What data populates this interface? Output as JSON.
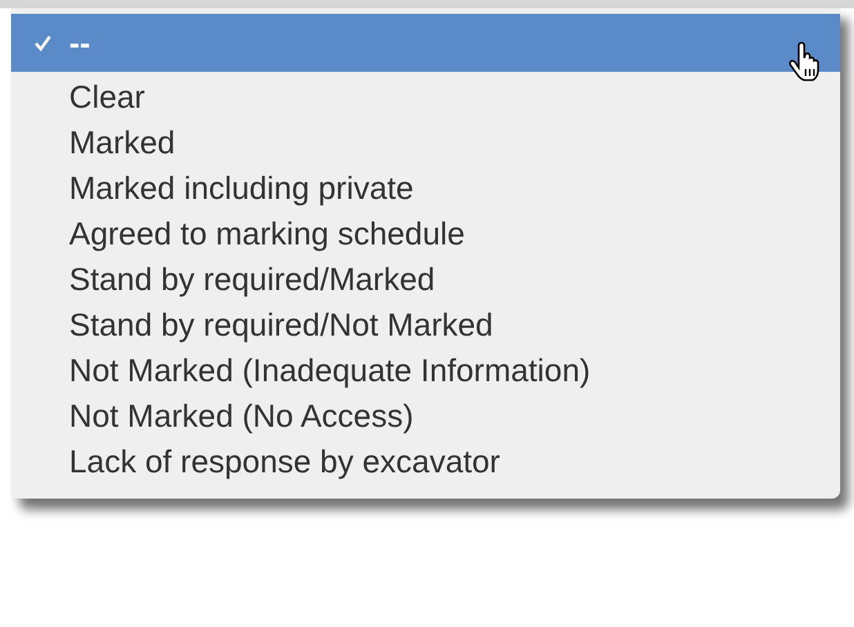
{
  "menu": {
    "items": [
      {
        "label": "--",
        "checked": true,
        "selected": true
      },
      {
        "label": "Clear",
        "checked": false,
        "selected": false
      },
      {
        "label": "Marked",
        "checked": false,
        "selected": false
      },
      {
        "label": "Marked including private",
        "checked": false,
        "selected": false
      },
      {
        "label": "Agreed to marking schedule",
        "checked": false,
        "selected": false
      },
      {
        "label": "Stand by required/Marked",
        "checked": false,
        "selected": false
      },
      {
        "label": "Stand by required/Not Marked",
        "checked": false,
        "selected": false
      },
      {
        "label": "Not Marked (Inadequate Information)",
        "checked": false,
        "selected": false
      },
      {
        "label": "Not Marked (No Access)",
        "checked": false,
        "selected": false
      },
      {
        "label": "Lack of response by excavator",
        "checked": false,
        "selected": false
      }
    ]
  }
}
